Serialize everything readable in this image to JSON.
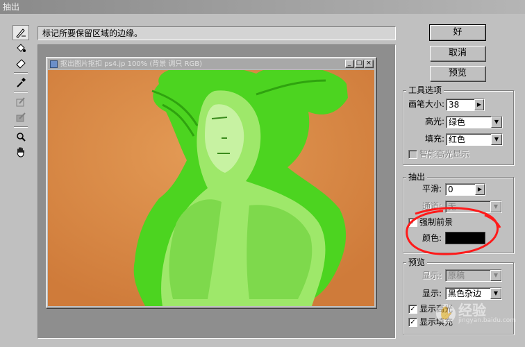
{
  "window": {
    "title": "抽出"
  },
  "toolbox": {
    "tools": [
      {
        "icon": "edge-highlighter-icon",
        "active": true
      },
      {
        "icon": "fill-bucket-icon"
      },
      {
        "icon": "eraser-icon"
      },
      {
        "icon": "eyedropper-icon"
      },
      {
        "icon": "cleanup-tool-icon"
      },
      {
        "icon": "edge-touchup-icon"
      },
      {
        "icon": "zoom-icon"
      },
      {
        "icon": "hand-icon"
      }
    ]
  },
  "hint": {
    "text": "标记所要保留区域的边缘。"
  },
  "document": {
    "title": "抠出图片抠扣  ps4.jp 100% (背景 调只  RGB)",
    "highlight_color": "#4cd420"
  },
  "buttons": {
    "ok": "好",
    "cancel": "取消",
    "preview": "预览"
  },
  "tool_options": {
    "title": "工具选项",
    "brush_size_label": "画笔大小:",
    "brush_size_value": "38",
    "highlight_label": "高光:",
    "highlight_value": "绿色",
    "fill_label": "填充:",
    "fill_value": "红色",
    "smart_highlight_label": "智能高光显示",
    "smart_highlight_checked": false
  },
  "extraction": {
    "title": "抽出",
    "smooth_label": "平滑:",
    "smooth_value": "0",
    "channel_label": "通道:",
    "channel_value": "无",
    "force_foreground_label": "强制前景",
    "force_foreground_checked": true,
    "color_label": "颜色:",
    "color_value": "#000000"
  },
  "preview": {
    "title": "预览",
    "show_label_1": "显示:",
    "show_value_1": "原稿",
    "show_label_2": "显示:",
    "show_value_2": "黑色杂边",
    "show_highlight_label": "显示高光",
    "show_highlight_checked": true,
    "show_fill_label": "显示填充",
    "show_fill_checked": true
  },
  "watermark": {
    "text": "经验",
    "sub": "jingyan.baidu.com"
  },
  "colors": {
    "annotation": "#ff1a1a",
    "canvas_bg": "#d98a45",
    "overlay": "#4cd420"
  }
}
